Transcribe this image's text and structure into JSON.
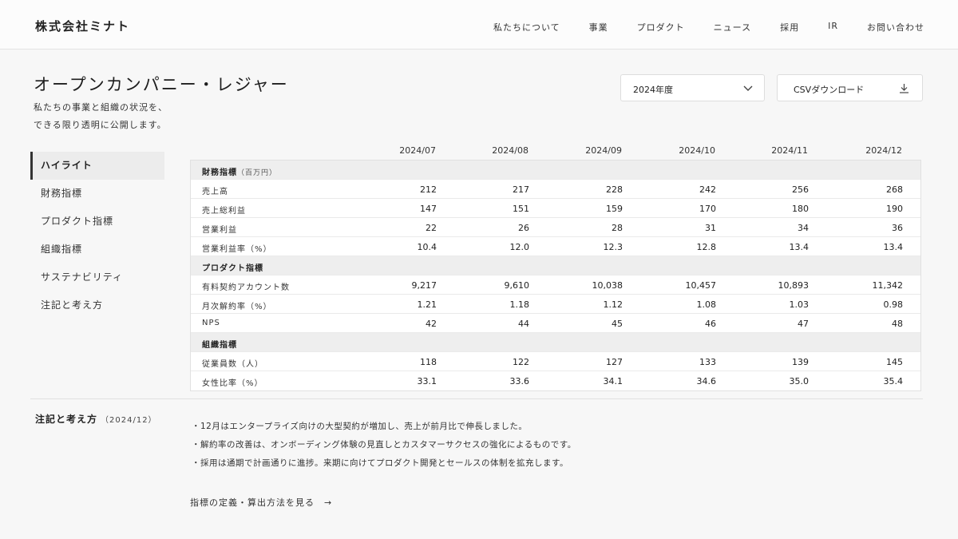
{
  "header": {
    "logo": "株式会社ミナト",
    "nav": [
      "私たちについて",
      "事業",
      "プロダクト",
      "ニュース",
      "採用",
      "IR",
      "お問い合わせ"
    ]
  },
  "page": {
    "title": "オープンカンパニー・レジャー",
    "description_line1": "私たちの事業と組織の状況を、",
    "description_line2": "できる限り透明に公開します。"
  },
  "controls": {
    "year_select": "2024年度",
    "csv_label": "CSVダウンロード"
  },
  "sidenav": {
    "items": [
      "ハイライト",
      "財務指標",
      "プロダクト指標",
      "組織指標",
      "サステナビリティ",
      "注記と考え方"
    ],
    "active_index": 0
  },
  "table": {
    "columns": [
      "2024/07",
      "2024/08",
      "2024/09",
      "2024/10",
      "2024/11",
      "2024/12"
    ],
    "rows": [
      {
        "type": "section",
        "label": "財務指標",
        "unit": "（百万円）"
      },
      {
        "type": "data",
        "label": "売上高",
        "values": [
          "212",
          "217",
          "228",
          "242",
          "256",
          "268"
        ]
      },
      {
        "type": "data",
        "label": "売上総利益",
        "values": [
          "147",
          "151",
          "159",
          "170",
          "180",
          "190"
        ]
      },
      {
        "type": "data",
        "label": "営業利益",
        "values": [
          "22",
          "26",
          "28",
          "31",
          "34",
          "36"
        ]
      },
      {
        "type": "data",
        "label": "営業利益率（%）",
        "values": [
          "10.4",
          "12.0",
          "12.3",
          "12.8",
          "13.4",
          "13.4"
        ]
      },
      {
        "type": "section",
        "label": "プロダクト指標",
        "unit": ""
      },
      {
        "type": "data",
        "label": "有料契約アカウント数",
        "values": [
          "9,217",
          "9,610",
          "10,038",
          "10,457",
          "10,893",
          "11,342"
        ]
      },
      {
        "type": "data",
        "label": "月次解約率（%）",
        "values": [
          "1.21",
          "1.18",
          "1.12",
          "1.08",
          "1.03",
          "0.98"
        ]
      },
      {
        "type": "data",
        "label": "NPS",
        "values": [
          "42",
          "44",
          "45",
          "46",
          "47",
          "48"
        ]
      },
      {
        "type": "section",
        "label": "組織指標",
        "unit": ""
      },
      {
        "type": "data",
        "label": "従業員数（人）",
        "values": [
          "118",
          "122",
          "127",
          "133",
          "139",
          "145"
        ]
      },
      {
        "type": "data",
        "label": "女性比率（%）",
        "values": [
          "33.1",
          "33.6",
          "34.1",
          "34.6",
          "35.0",
          "35.4"
        ]
      }
    ]
  },
  "notes": {
    "title": "注記と考え方",
    "period": "（2024/12）",
    "items": [
      "・12月はエンタープライズ向けの大型契約が増加し、売上が前月比で伸長しました。",
      "・解約率の改善は、オンボーディング体験の見直しとカスタマーサクセスの強化によるものです。",
      "・採用は通期で計画通りに進捗。来期に向けてプロダクト開発とセールスの体制を拡充します。"
    ],
    "link_label": "指標の定義・算出方法を見る",
    "link_arrow": "→"
  }
}
